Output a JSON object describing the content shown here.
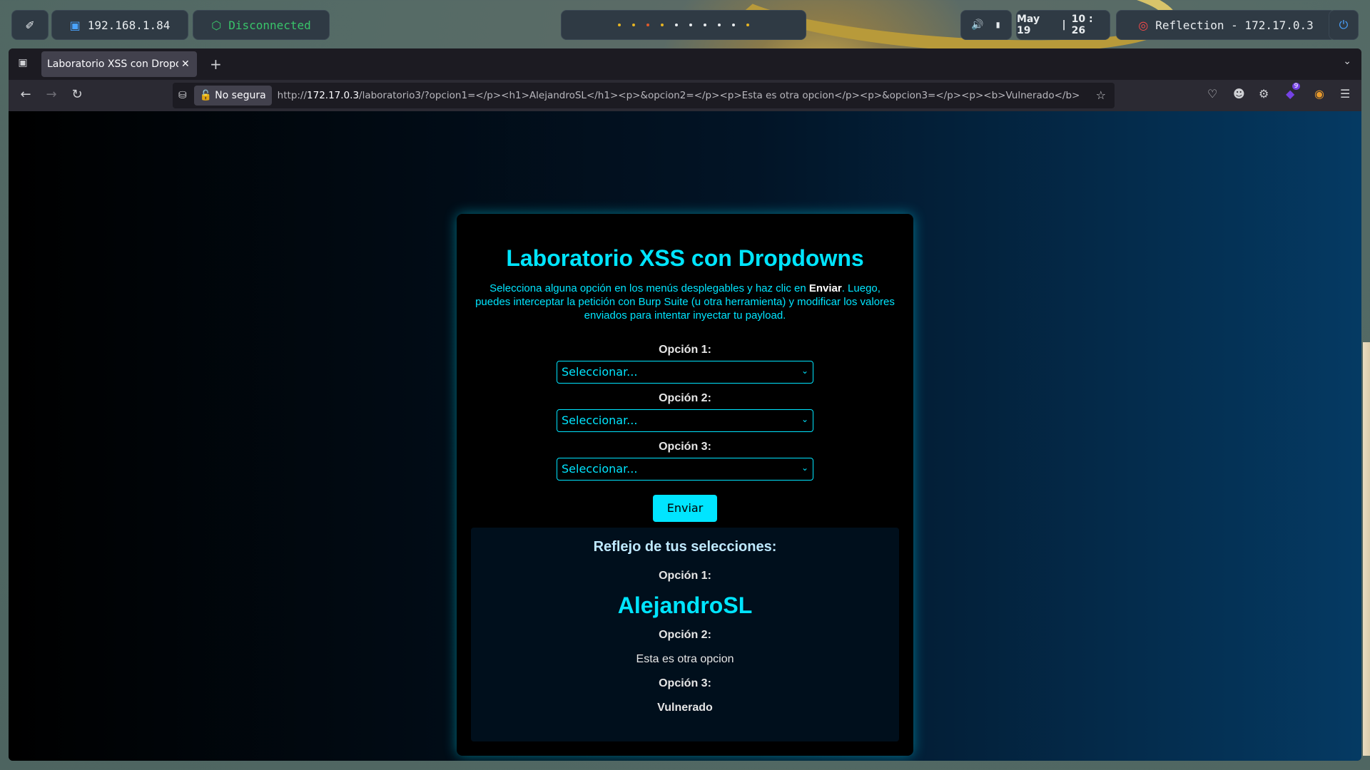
{
  "taskbar": {
    "ip": "192.168.1.84",
    "vpn_status": "Disconnected",
    "date": "May 19",
    "time": "10 : 26",
    "target": "Reflection - 172.17.0.3",
    "workspace_dot_colors": [
      "#e6b422",
      "#e6b422",
      "#e05a2b",
      "#e6b422",
      "#e8ecef",
      "#e8ecef",
      "#e8ecef",
      "#e8ecef",
      "#e8ecef",
      "#e6b422"
    ]
  },
  "browser": {
    "tab_title": "Laboratorio XSS con Dropdowns",
    "security_label": "No segura",
    "url_prefix": "http://",
    "url_host": "172.17.0.3",
    "url_rest": "/laboratorio3/?opcion1=</p><h1>AlejandroSL</h1><p>&opcion2=</p><p>Esta es otra opcion</p><p>&opcion3=</p><p><b>Vulnerado</b>",
    "extension_badge": "9"
  },
  "page": {
    "title": "Laboratorio XSS con Dropdowns",
    "desc_before": "Selecciona alguna opción en los menús desplegables y haz clic en ",
    "desc_bold": "Enviar",
    "desc_after": ". Luego, puedes interceptar la petición con Burp Suite (u otra herramienta) y modificar los valores enviados para intentar inyectar tu payload.",
    "options": [
      {
        "label": "Opción 1:",
        "selected": "Seleccionar..."
      },
      {
        "label": "Opción 2:",
        "selected": "Seleccionar..."
      },
      {
        "label": "Opción 3:",
        "selected": "Seleccionar..."
      }
    ],
    "submit_label": "Enviar",
    "result": {
      "heading": "Reflejo de tus selecciones:",
      "label1": "Opción 1:",
      "value1": "AlejandroSL",
      "label2": "Opción 2:",
      "value2": "Esta es otra opcion",
      "label3": "Opción 3:",
      "value3": "Vulnerado"
    }
  },
  "colors": {
    "accent": "#00e5ff"
  }
}
